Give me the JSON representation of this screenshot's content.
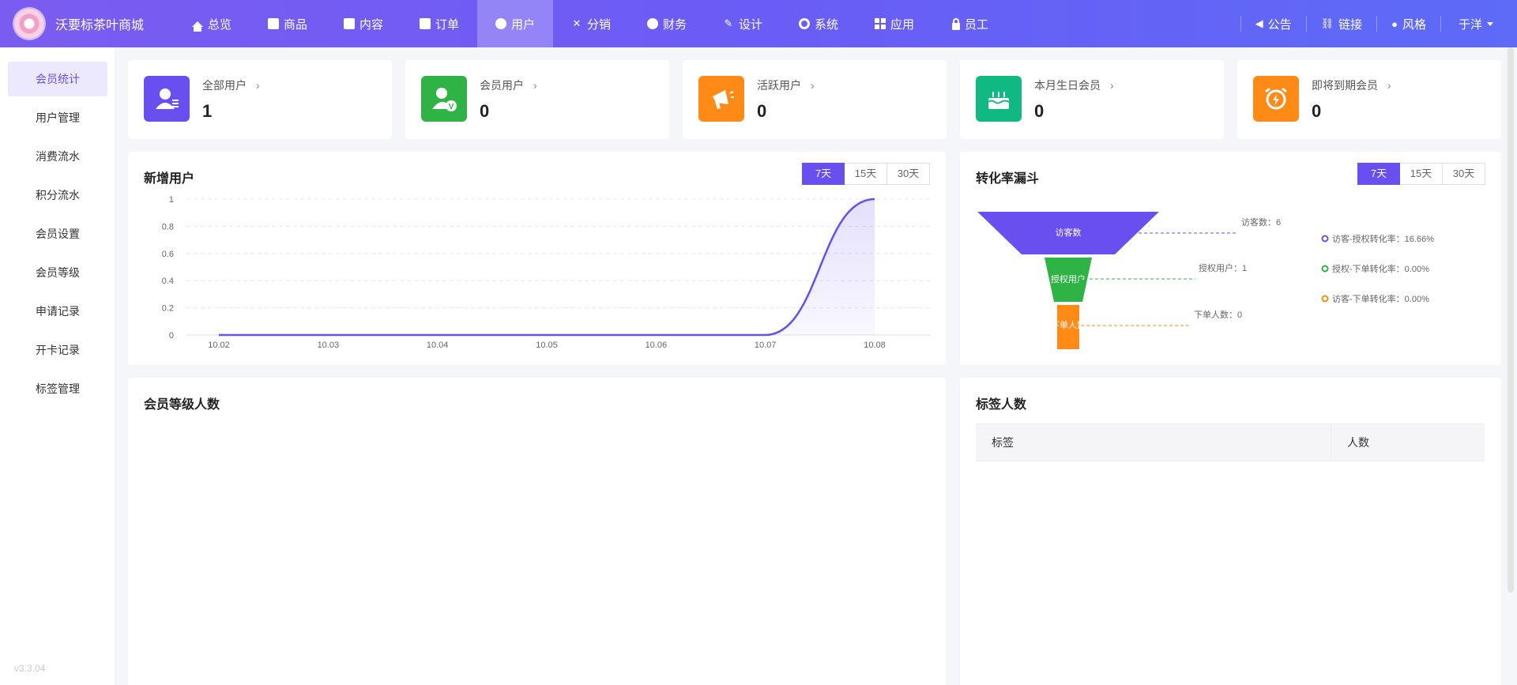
{
  "app": {
    "title": "沃要标茶叶商城"
  },
  "nav": [
    {
      "label": "总览",
      "icon": "home-icon",
      "active": false
    },
    {
      "label": "商品",
      "icon": "bag-icon",
      "active": false
    },
    {
      "label": "内容",
      "icon": "document-icon",
      "active": false
    },
    {
      "label": "订单",
      "icon": "clipboard-icon",
      "active": false
    },
    {
      "label": "用户",
      "icon": "user-icon",
      "active": true
    },
    {
      "label": "分销",
      "icon": "share-icon",
      "active": false
    },
    {
      "label": "财务",
      "icon": "money-bag-icon",
      "active": false
    },
    {
      "label": "设计",
      "icon": "brush-icon",
      "active": false
    },
    {
      "label": "系统",
      "icon": "gear-icon",
      "active": false
    },
    {
      "label": "应用",
      "icon": "grid-icon",
      "active": false
    },
    {
      "label": "员工",
      "icon": "lock-icon",
      "active": false
    }
  ],
  "tools": [
    {
      "label": "公告",
      "icon": "megaphone-icon"
    },
    {
      "label": "链接",
      "icon": "link-icon"
    },
    {
      "label": "风格",
      "icon": "palette-icon"
    }
  ],
  "user": {
    "name": "于洋"
  },
  "sidebar": {
    "items": [
      {
        "label": "会员统计",
        "active": true
      },
      {
        "label": "用户管理",
        "active": false
      },
      {
        "label": "消费流水",
        "active": false
      },
      {
        "label": "积分流水",
        "active": false
      },
      {
        "label": "会员设置",
        "active": false
      },
      {
        "label": "会员等级",
        "active": false
      },
      {
        "label": "申请记录",
        "active": false
      },
      {
        "label": "开卡记录",
        "active": false
      },
      {
        "label": "标签管理",
        "active": false
      }
    ],
    "version": "v3.3.04"
  },
  "stats": [
    {
      "label": "全部用户",
      "value": "1",
      "color": "#6a4ff0",
      "icon": "all-users-icon"
    },
    {
      "label": "会员用户",
      "value": "0",
      "color": "#2fb344",
      "icon": "member-user-icon"
    },
    {
      "label": "活跃用户",
      "value": "0",
      "color": "#ff8a16",
      "icon": "megaphone-icon"
    },
    {
      "label": "本月生日会员",
      "value": "0",
      "color": "#10b981",
      "icon": "birthday-cake-icon"
    },
    {
      "label": "即将到期会员",
      "value": "0",
      "color": "#ff8a16",
      "icon": "alarm-clock-icon"
    }
  ],
  "new_users": {
    "title": "新增用户",
    "ranges": [
      "7天",
      "15天",
      "30天"
    ],
    "active_range": "7天"
  },
  "funnel": {
    "title": "转化率漏斗",
    "ranges": [
      "7天",
      "15天",
      "30天"
    ],
    "active_range": "7天",
    "stages": [
      {
        "label": "访客数",
        "callout": "访客数：6",
        "color": "#6a4ff0"
      },
      {
        "label": "授权用户",
        "callout": "授权用户：1",
        "color": "#2fb344"
      },
      {
        "label": "下单人数",
        "callout": "下单人数：0",
        "color": "#ff8a16"
      }
    ],
    "rates": [
      {
        "label": "访客-授权转化率：16.66%",
        "color": "#6a4ff0"
      },
      {
        "label": "授权-下单转化率：0.00%",
        "color": "#2fb344"
      },
      {
        "label": "访客-下单转化率：0.00%",
        "color": "#ff8a16"
      }
    ]
  },
  "member_levels": {
    "title": "会员等级人数"
  },
  "tags": {
    "title": "标签人数",
    "columns": [
      "标签",
      "人数"
    ]
  },
  "chart_data": {
    "type": "line",
    "x": [
      "10.02",
      "10.03",
      "10.04",
      "10.05",
      "10.06",
      "10.07",
      "10.08"
    ],
    "series": [
      {
        "values": [
          0,
          0,
          0,
          0,
          0,
          0,
          1
        ]
      }
    ],
    "y_ticks": [
      "0",
      "0.2",
      "0.4",
      "0.6",
      "0.8",
      "1"
    ],
    "ylim": [
      0,
      1
    ],
    "smooth": true,
    "area": true,
    "grid": "dashed horizontal",
    "color": "#6a4ff0"
  }
}
